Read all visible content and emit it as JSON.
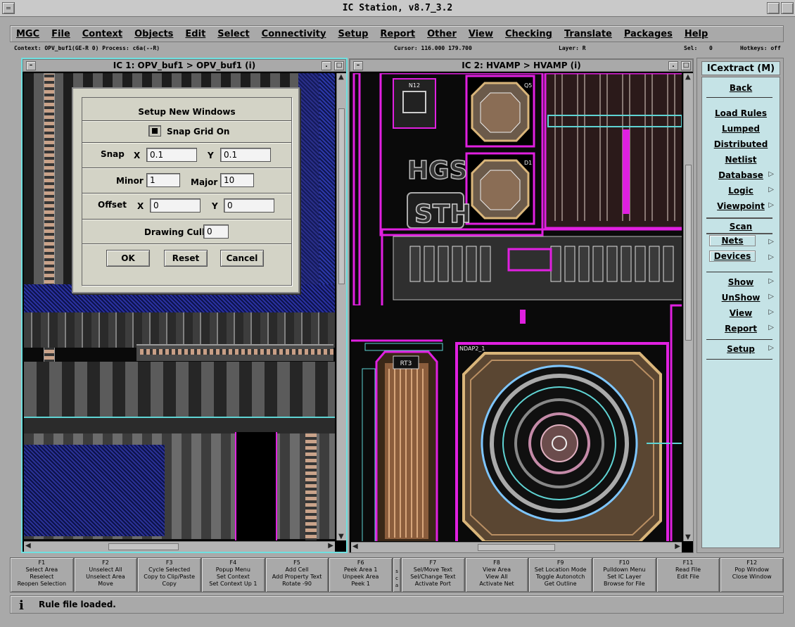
{
  "window": {
    "title": "IC Station, v8.7_3.2"
  },
  "menu": [
    "MGC",
    "File",
    "Context",
    "Objects",
    "Edit",
    "Select",
    "Connectivity",
    "Setup",
    "Report",
    "Other",
    "View",
    "Checking",
    "Translate",
    "Packages",
    "Help"
  ],
  "context_bar": {
    "context": "Context: OPV_buf1(GE-R 0)  Process: c6a(--R)",
    "cursor": "Cursor: 116.000  179.700",
    "layer": "Layer: R",
    "sel": "Sel:",
    "sel_value": "0",
    "hotkeys": "Hotkeys: off"
  },
  "ic1": {
    "title": "IC 1: OPV_buf1 > OPV_buf1 (i)"
  },
  "ic2": {
    "title": "IC 2: HVAMP > HVAMP (i)",
    "labels": {
      "hgs": "HGS",
      "sth": "STH",
      "n12": "N12",
      "q5": "Q5",
      "d1": "D1",
      "rt3": "RT3",
      "pad": "NDAP2_1"
    }
  },
  "dialog": {
    "title": "Setup New Windows",
    "snap_grid_label": "Snap Grid On",
    "snap_label": "Snap",
    "x_label": "X",
    "y_label": "Y",
    "snap_x": "0.1",
    "snap_y": "0.1",
    "minor_label": "Minor",
    "minor_value": "1",
    "major_label": "Major",
    "major_value": "10",
    "offset_label": "Offset",
    "offset_x": "0",
    "offset_y": "0",
    "drawing_cull_label": "Drawing Cull",
    "drawing_cull_value": "0",
    "ok": "OK",
    "reset": "Reset",
    "cancel": "Cancel"
  },
  "palette": {
    "title": "ICextract (M)",
    "back": "Back",
    "load_rules": "Load Rules",
    "lumped": "Lumped",
    "distributed": "Distributed",
    "netlist": "Netlist",
    "database": "Database",
    "logic": "Logic",
    "viewpoint": "Viewpoint",
    "scan": "Scan",
    "nets": "Nets",
    "devices": "Devices",
    "show": "Show",
    "unshow": "UnShow",
    "view": "View",
    "report": "Report",
    "setup": "Setup"
  },
  "fkeys": [
    {
      "key": "F1",
      "l1": "Select Area",
      "l2": "Reselect",
      "l3": "Reopen Selection"
    },
    {
      "key": "F2",
      "l1": "Unselect All",
      "l2": "Unselect Area",
      "l3": "Move"
    },
    {
      "key": "F3",
      "l1": "Cycle Selected",
      "l2": "Copy to Clip/Paste",
      "l3": "Copy"
    },
    {
      "key": "F4",
      "l1": "Popup Menu",
      "l2": "Set Context",
      "l3": "Set Context Up 1"
    },
    {
      "key": "F5",
      "l1": "Add Cell",
      "l2": "Add Property Text",
      "l3": "Rotate -90"
    },
    {
      "key": "F6",
      "l1": "Peek Area 1",
      "l2": "Unpeek Area",
      "l3": "Peek 1"
    },
    {
      "key": "F7",
      "l1": "Sel/Move Text",
      "l2": "Sel/Change Text",
      "l3": "Activate Port"
    },
    {
      "key": "F8",
      "l1": "View Area",
      "l2": "View All",
      "l3": "Activate Net"
    },
    {
      "key": "F9",
      "l1": "Set Location Mode",
      "l2": "Toggle Autonotch",
      "l3": "Get Outline"
    },
    {
      "key": "F10",
      "l1": "Pulldown Menu",
      "l2": "Set IC Layer",
      "l3": "Browse for File"
    },
    {
      "key": "F11",
      "l1": "Read File",
      "l2": "Edit File",
      "l3": ""
    },
    {
      "key": "F12",
      "l1": "Pop Window",
      "l2": "Close Window",
      "l3": ""
    }
  ],
  "fkey_sep": [
    "s",
    "c",
    "a"
  ],
  "status": {
    "icon": "i",
    "message": "Rule file loaded."
  }
}
